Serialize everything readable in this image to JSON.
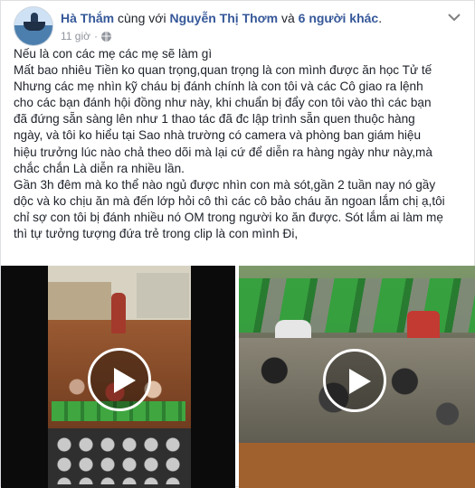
{
  "author": {
    "name": "Hà Thắm",
    "with_text": " cùng với ",
    "tagged": "Nguyễn Thị Thơm",
    "and_text": " và ",
    "others": "6 người khác",
    "end": "."
  },
  "meta": {
    "time": "11 giờ",
    "separator": "·",
    "privacy_icon": "globe-icon"
  },
  "menu_icon": "chevron-down-icon",
  "post_lines": [
    "Nếu là con các mẹ các mẹ sẽ làm gì",
    "Mất bao nhiêu Tiền ko quan trọng,quan trọng là con mình được ăn học Tử tế",
    "Nhưng các mẹ nhìn kỹ cháu bị đánh chính là con tôi và các Cô giao ra lệnh",
    "cho các bạn đánh hội đồng như này, khi chuẩn bị đẩy con tôi vào thì các bạn",
    "đã đứng sẵn sàng lên như 1 thao tác đã đc lập trình sẵn quen thuộc hàng",
    "ngày, và tôi ko hiểu tại Sao nhà trường có camera và phòng ban giám hiệu",
    "hiệu trưởng lúc nào chả theo dõi mà lại cứ để diễn ra hàng ngày như này,mà",
    "chắc chắn Là diễn ra nhiều lần.",
    "Gần 3h đêm mà ko thể nào ngủ được nhìn con mà sót,gần 2 tuần nay nó gầy",
    "dộc và ko chịu ăn mà đến lớp hỏi cô thì các cô bảo cháu ăn ngoan lắm chị ạ,tôi",
    "chỉ sợ con tôi bị đánh nhiều nó OM trong người ko ăn được. Sót lắm ai làm mẹ",
    "thì tự tưởng tượng đứa trẻ trong clip là con mình Đi,"
  ],
  "videos": [
    {
      "name": "video-left",
      "icon": "play-icon"
    },
    {
      "name": "video-right",
      "icon": "play-icon"
    }
  ]
}
